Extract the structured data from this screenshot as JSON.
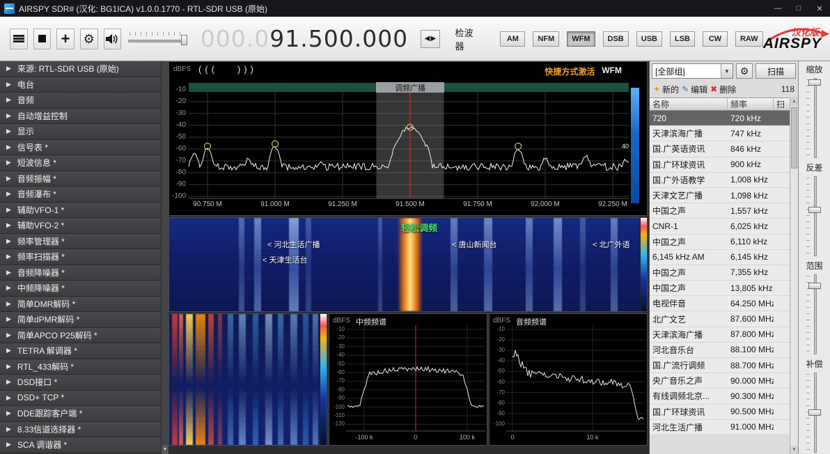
{
  "titlebar": {
    "title": "AIRSPY SDR#  (汉化:  BG1ICA)  v1.0.0.1770 - RTL-SDR USB  (原始)"
  },
  "icons": {
    "minimize": "—",
    "maximize": "□",
    "close": "✕",
    "gear": "⚙",
    "plus": "+",
    "tune_left": "◀",
    "tune_right": "▶",
    "sidebar_arrow": "▶",
    "dropdown_arrow": "▼",
    "scroll_up": "▲",
    "scroll_down": "▼",
    "new": "✦",
    "edit": "✎",
    "delete": "✖"
  },
  "toolbar": {
    "freq_dim": "000.0",
    "freq_main": "91.500.000",
    "detector_label": "检波器",
    "modes": [
      "AM",
      "NFM",
      "WFM",
      "DSB",
      "USB",
      "LSB",
      "CW",
      "RAW"
    ],
    "active_mode": "WFM",
    "logo_badge": "汉化版",
    "logo_text": "AIRSPY"
  },
  "sidebar": {
    "items": [
      "来源:  RTL-SDR USB  (原始)",
      "电台",
      "音频",
      "自动增益控制",
      "显示",
      "信号表 *",
      "短波信息 *",
      "音频振幅 *",
      "音频瀑布 *",
      "辅助VFO-1 *",
      "辅助VFO-2 *",
      "频率管理器 *",
      "频率扫描器 *",
      "音频降噪器 *",
      "中频降噪器 *",
      "简单DMR解码 *",
      "简单dPMR解码 *",
      "简单APCO P25解码 *",
      "TETRA 解调器 *",
      "RTL_433解码 *",
      "DSD接口 *",
      "DSD+ TCP *",
      "DDE跟踪客户端 *",
      "8.33信道选择器 *",
      "SCA 调谐器 *"
    ]
  },
  "spectrum": {
    "unit": "dBFS",
    "squelch_left": "(((",
    "squelch_right": ")))",
    "hotkey_text": "快捷方式激活",
    "hotkey_mode": "WFM",
    "band_label": "调频广播",
    "meter_value": "40",
    "y_ticks": [
      "-10",
      "-20",
      "-30",
      "-40",
      "-50",
      "-60",
      "-70",
      "-80",
      "-90",
      "-100"
    ],
    "x_ticks": [
      "90.750 M",
      "91.000 M",
      "91.250 M",
      "91.500 M",
      "91.750 M",
      "92.000 M",
      "92.250 M"
    ],
    "chart": {
      "type": "line",
      "tuned": 91.5,
      "bandwidth": 0.25,
      "tick_freqs": [
        90.75,
        91.0,
        91.25,
        91.5,
        91.75,
        92.0,
        92.25
      ],
      "noise_floor": -75,
      "peaks": [
        [
          90.7,
          -64,
          0.02
        ],
        [
          90.75,
          -60,
          0.018
        ],
        [
          90.9,
          -69,
          0.02
        ],
        [
          91.0,
          -58,
          0.02
        ],
        [
          91.17,
          -71,
          0.02
        ],
        [
          91.46,
          -55,
          0.02
        ],
        [
          91.5,
          -42,
          0.045
        ],
        [
          91.56,
          -56,
          0.015
        ],
        [
          91.9,
          -60,
          0.02
        ],
        [
          92.0,
          -68,
          0.018
        ],
        [
          92.15,
          -66,
          0.02
        ],
        [
          92.3,
          -69,
          0.02
        ]
      ],
      "markers": [
        [
          90.75,
          -60
        ],
        [
          91.0,
          -58
        ],
        [
          91.5,
          -44
        ],
        [
          91.9,
          -60
        ]
      ]
    }
  },
  "waterfall": {
    "highlight_label": "轻松调频",
    "stations": [
      "< 河北生活广播",
      "< 天津生活台",
      "< 唐山新闻台",
      "< 北广外语"
    ]
  },
  "if_spectrum": {
    "unit": "dBFS",
    "title": "中频频谱",
    "y_ticks": [
      "-10",
      "-20",
      "-30",
      "-40",
      "-50",
      "-60",
      "-70",
      "-80",
      "-90",
      "-100",
      "-110",
      "-120"
    ],
    "x_ticks": [
      "-100 k",
      "0",
      "100 k"
    ],
    "chart": {
      "type": "line",
      "plateau_db": -56,
      "edge_db": -100,
      "plateau_halfwidth_khz": 92
    }
  },
  "audio_spectrum": {
    "unit": "dBFS",
    "title": "音频频谱",
    "y_ticks": [
      "-10",
      "-20",
      "-30",
      "-40",
      "-50",
      "-60",
      "-70",
      "-80",
      "-90",
      "-100"
    ],
    "x_ticks": [
      "0",
      "10 k"
    ],
    "chart": {
      "type": "line",
      "start_db": -33,
      "mid_db": -52,
      "end_db": -63,
      "cutoff_khz": 14.8,
      "floor_db": -94
    }
  },
  "freq_manager": {
    "group_selected": "[全部组]",
    "scan_label": "扫描",
    "new_label": "新的",
    "edit_label": "编辑",
    "delete_label": "删除",
    "count": "118",
    "columns": [
      "名称",
      "频率",
      "扫"
    ],
    "selected_index": 0,
    "rows": [
      {
        "name": "720",
        "freq": "720 kHz"
      },
      {
        "name": "天津滨海广播",
        "freq": "747 kHz"
      },
      {
        "name": "国.广英语资讯",
        "freq": "846 kHz"
      },
      {
        "name": "国.广环球资讯",
        "freq": "900 kHz"
      },
      {
        "name": "国.广外语教学",
        "freq": "1,008 kHz"
      },
      {
        "name": "天津文艺广播",
        "freq": "1,098 kHz"
      },
      {
        "name": "中国之声",
        "freq": "1,557 kHz"
      },
      {
        "name": "CNR-1",
        "freq": "6,025 kHz"
      },
      {
        "name": "中国之声",
        "freq": "6,110 kHz"
      },
      {
        "name": "6,145 kHz AM",
        "freq": "6,145 kHz"
      },
      {
        "name": "中国之声",
        "freq": "7,355 kHz"
      },
      {
        "name": "中国之声",
        "freq": "13,805 kHz"
      },
      {
        "name": "电视伴音",
        "freq": "64.250 MHz"
      },
      {
        "name": "北广文艺",
        "freq": "87.600 MHz"
      },
      {
        "name": "天津滨海广播",
        "freq": "87.800 MHz"
      },
      {
        "name": "河北音乐台",
        "freq": "88.100 MHz"
      },
      {
        "name": "国.广流行调频",
        "freq": "88.700 MHz"
      },
      {
        "name": "央广音乐之声",
        "freq": "90.000 MHz"
      },
      {
        "name": "有线调频北京...",
        "freq": "90.300 MHz"
      },
      {
        "name": "国.广环球资讯",
        "freq": "90.500 MHz"
      },
      {
        "name": "河北生活广播",
        "freq": "91.000 MHz"
      }
    ]
  },
  "right_controls": {
    "labels": [
      "缩放",
      "反差",
      "范围",
      "补偿"
    ]
  }
}
